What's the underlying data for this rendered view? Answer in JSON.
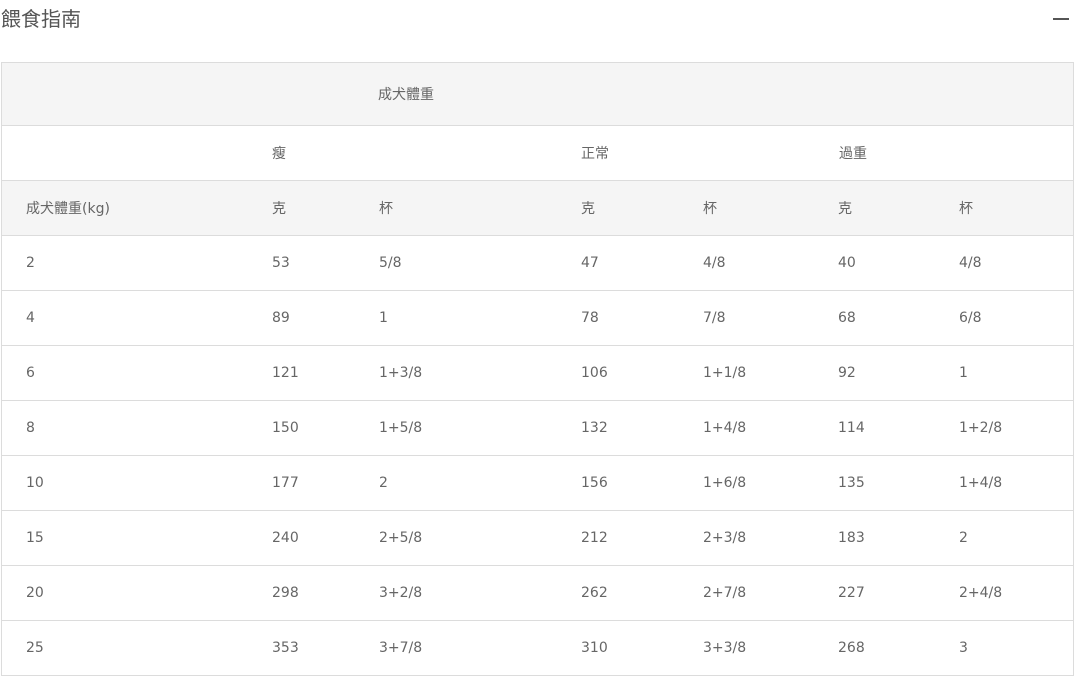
{
  "header": {
    "title": "餵食指南",
    "collapse_icon": "minus-icon"
  },
  "table": {
    "group_header": "成犬體重",
    "body_conditions": [
      "瘦",
      "正常",
      "過重"
    ],
    "units": {
      "weight_label": "成犬體重(kg)",
      "grams": "克",
      "cups": "杯"
    },
    "rows": [
      {
        "weight": "2",
        "thin_g": "53",
        "thin_cup": "5/8",
        "normal_g": "47",
        "normal_cup": "4/8",
        "over_g": "40",
        "over_cup": "4/8"
      },
      {
        "weight": "4",
        "thin_g": "89",
        "thin_cup": "1",
        "normal_g": "78",
        "normal_cup": "7/8",
        "over_g": "68",
        "over_cup": "6/8"
      },
      {
        "weight": "6",
        "thin_g": "121",
        "thin_cup": "1+3/8",
        "normal_g": "106",
        "normal_cup": "1+1/8",
        "over_g": "92",
        "over_cup": "1"
      },
      {
        "weight": "8",
        "thin_g": "150",
        "thin_cup": "1+5/8",
        "normal_g": "132",
        "normal_cup": "1+4/8",
        "over_g": "114",
        "over_cup": "1+2/8"
      },
      {
        "weight": "10",
        "thin_g": "177",
        "thin_cup": "2",
        "normal_g": "156",
        "normal_cup": "1+6/8",
        "over_g": "135",
        "over_cup": "1+4/8"
      },
      {
        "weight": "15",
        "thin_g": "240",
        "thin_cup": "2+5/8",
        "normal_g": "212",
        "normal_cup": "2+3/8",
        "over_g": "183",
        "over_cup": "2"
      },
      {
        "weight": "20",
        "thin_g": "298",
        "thin_cup": "3+2/8",
        "normal_g": "262",
        "normal_cup": "2+7/8",
        "over_g": "227",
        "over_cup": "2+4/8"
      },
      {
        "weight": "25",
        "thin_g": "353",
        "thin_cup": "3+7/8",
        "normal_g": "310",
        "normal_cup": "3+3/8",
        "over_g": "268",
        "over_cup": "3"
      }
    ]
  }
}
